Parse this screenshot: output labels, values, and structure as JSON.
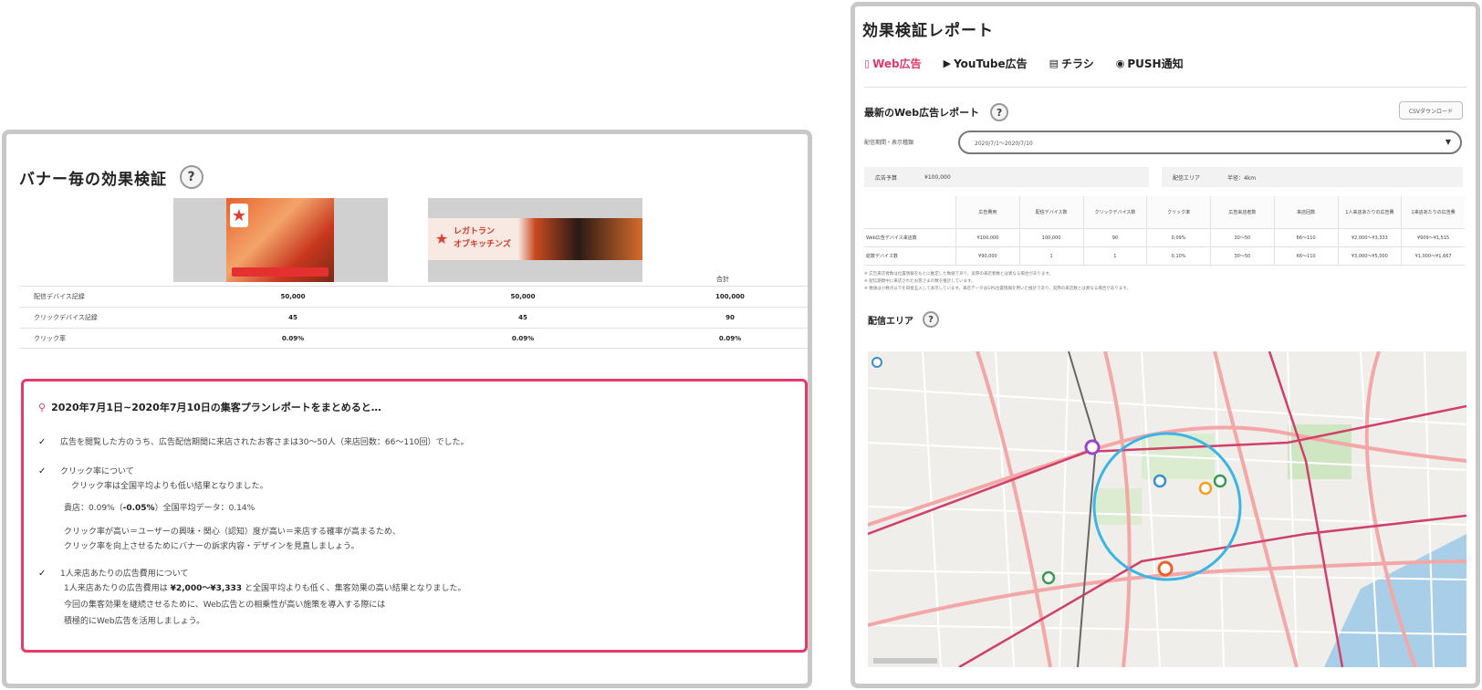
{
  "left": {
    "title": "バナー毎の効果検証",
    "help": "?",
    "banner_b_text_line1": "レガトラン",
    "banner_b_text_line2": "オブキッチンズ",
    "total_label": "合計",
    "rows": [
      {
        "label": "配信デバイス記録",
        "a": "50,000",
        "b": "50,000",
        "total": "100,000"
      },
      {
        "label": "クリックデバイス記録",
        "a": "45",
        "b": "45",
        "total": "90"
      },
      {
        "label": "クリック率",
        "a": "0.09%",
        "b": "0.09%",
        "total": "0.09%"
      }
    ],
    "summary": {
      "heading": "2020年7月1日~2020年7月10日の集客プランレポートをまとめると…",
      "item1": "広告を閲覧した方のうち、広告配信期間に来店されたお客さまは30〜50人（来店回数：66〜110回）でした。",
      "item2_line1": "クリック率について",
      "item2_line2": "クリック率は全国平均よりも低い結果となりました。",
      "item2_stat_prefix": "貴店：0.09%（",
      "item2_stat_diff": "-0.05%",
      "item2_stat_suffix": "）全国平均データ：0.14%",
      "item2_line3": "クリック率が高い＝ユーザーの興味・関心（認知）度が高い＝来店する確率が高まるため、",
      "item2_line4": "クリック率を向上させるためにバナーの訴求内容・デザインを見直しましょう。",
      "item3_line1": "1人来店あたりの広告費用について",
      "item3_line2_prefix": "1人来店あたりの広告費用は",
      "item3_line2_value": "¥2,000〜¥3,333",
      "item3_line2_suffix": "と全国平均よりも低く、集客効果の高い結果となりました。",
      "item3_line3": "今回の集客効果を継続させるために、Web広告との相乗性が高い施策を導入する際には",
      "item3_line4": "積極的にWeb広告を活用しましょう。"
    }
  },
  "right": {
    "title": "効果検証レポート",
    "tabs": [
      {
        "label": "Web広告",
        "icon": "mobile-icon",
        "active": true
      },
      {
        "label": "YouTube広告",
        "icon": "youtube-icon",
        "active": false
      },
      {
        "label": "チラシ",
        "icon": "flyer-icon",
        "active": false
      },
      {
        "label": "PUSH通知",
        "icon": "push-icon",
        "active": false
      }
    ],
    "subtitle": "最新のWeb広告レポート",
    "help": "?",
    "csv_button": "CSVダウンロード",
    "period_label": "配信期間・表示種類",
    "period_value": "2020/7/1〜2020/7/10",
    "budget_label": "広告予算",
    "budget_value": "¥100,000",
    "area_label": "配信エリア",
    "area_value": "半径：4km",
    "table_headers": [
      "広告費用",
      "配信デバイス数",
      "クリックデバイス数",
      "クリック率",
      "広告来店者数",
      "来店回数",
      "1人来店あたりの広告費",
      "1来店あたりの広告費"
    ],
    "table_rows": [
      {
        "name": "Web広告デバイス来店数",
        "cells": [
          "¥100,000",
          "100,000",
          "90",
          "0.09%",
          "30〜50",
          "66〜110",
          "¥2,000〜¥3,333",
          "¥909〜¥1,515"
        ]
      },
      {
        "name": "総数デバイス数",
        "cells": [
          "¥90,000",
          "1",
          "1",
          "0.10%",
          "30〜50",
          "66〜110",
          "¥3,000〜¥5,000",
          "¥1,000〜¥1,667"
        ]
      }
    ],
    "notes_line1": "※ 広告来店者数は位置情報をもとに推定した数値であり、実際の来店者数とは異なる場合があります。",
    "notes_line2": "※ 配信期間中に来店されたお客さまの数を推計しています。",
    "notes_line3": "※ 数値は小数点以下を四捨五入して表示しています。来店データはGPS位置情報を用いた推計であり、実際の来店数とは異なる場合があります。",
    "map_title": "配信エリア",
    "map_help": "?",
    "colors": {
      "accent": "#e23a6a",
      "circle": "#3bb4e6"
    }
  }
}
